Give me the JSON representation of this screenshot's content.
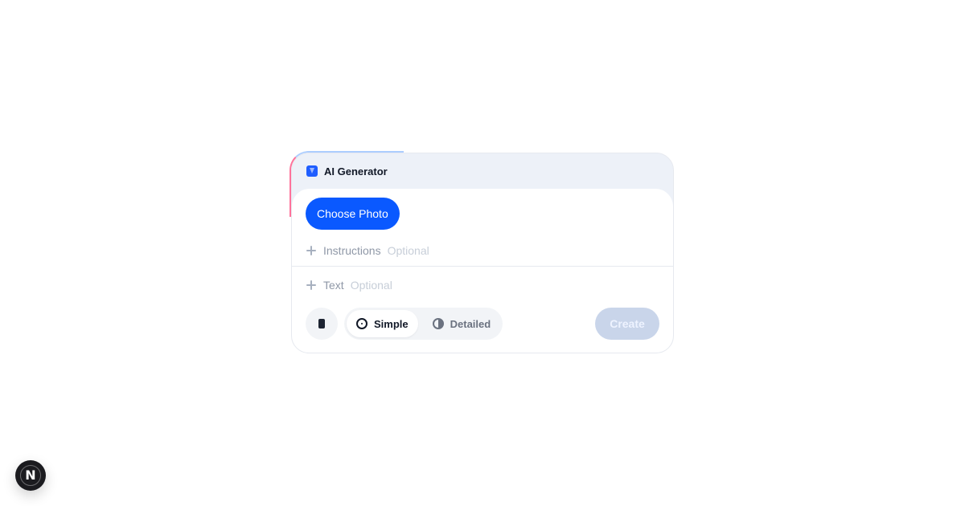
{
  "card": {
    "title": "AI Generator",
    "choose_button": "Choose Photo",
    "fields": {
      "instructions": {
        "label": "Instructions",
        "optional": "Optional"
      },
      "text": {
        "label": "Text",
        "optional": "Optional"
      }
    },
    "mode": {
      "options": [
        {
          "label": "Simple",
          "icon": "target-icon",
          "selected": true
        },
        {
          "label": "Detailed",
          "icon": "half-circle-icon",
          "selected": false
        }
      ]
    },
    "create_button": "Create"
  },
  "badge": {
    "letter": "N"
  },
  "colors": {
    "primary": "#0a59ff",
    "create_disabled_bg": "#c9d5ea"
  }
}
